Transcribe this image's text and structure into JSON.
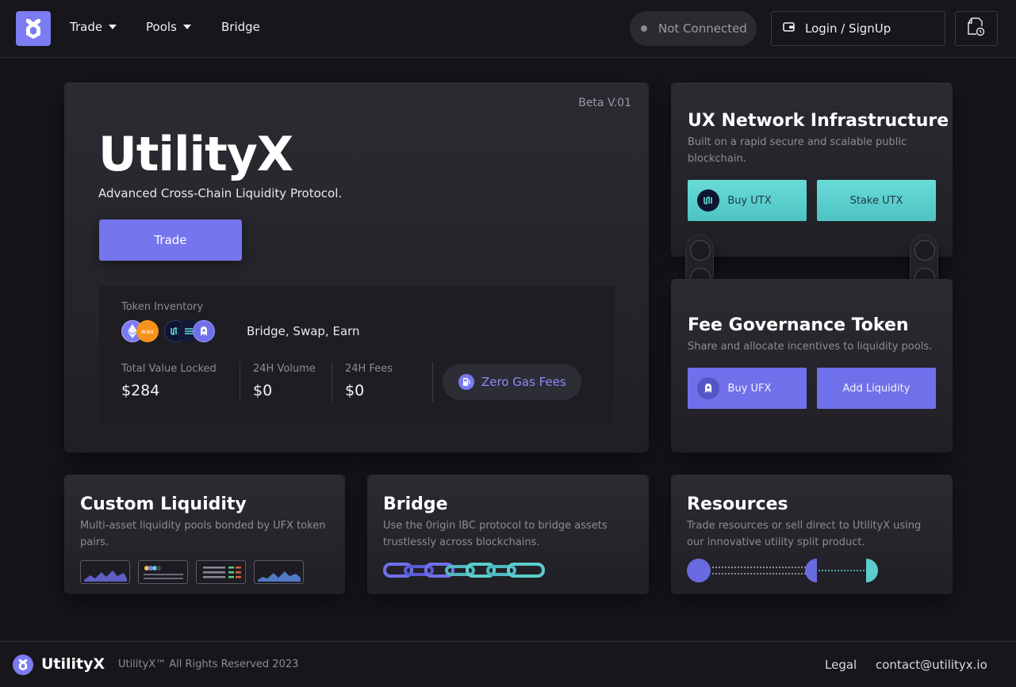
{
  "header": {
    "logo_icon": "utilityx-logo-icon",
    "nav": [
      {
        "label": "Trade",
        "has_dropdown": true
      },
      {
        "label": "Pools",
        "has_dropdown": true
      },
      {
        "label": "Bridge",
        "has_dropdown": false
      }
    ],
    "connection_status": "Not Connected",
    "login_label": "Login / SignUp",
    "login_icon": "wallet-icon",
    "docs_icon": "document-clock-icon"
  },
  "hero": {
    "version": "Beta V.01",
    "title": "UtilityX",
    "subtitle": "Advanced Cross-Chain Liquidity Protocol.",
    "trade_label": "Trade",
    "inventory": {
      "label": "Token Inventory",
      "coin_icons": [
        "eth-icon",
        "wax-icon",
        "utx-icon",
        "bridge-token-icon",
        "ufx-icon"
      ],
      "tagline": "Bridge, Swap, Earn",
      "stats": [
        {
          "label": "Total Value Locked",
          "value": "$284"
        },
        {
          "label": "24H Volume",
          "value": "$0"
        },
        {
          "label": "24H Fees",
          "value": "$0"
        }
      ],
      "gas_label": "Zero Gas Fees",
      "gas_icon": "gas-pump-icon"
    }
  },
  "ux_card": {
    "title": "UX Network Infrastructure",
    "description": "Built on a rapid secure and scalable public blockchain.",
    "buy_label": "Buy UTX",
    "stake_label": "Stake UTX"
  },
  "fee_card": {
    "title": "Fee Governance Token",
    "description": "Share and allocate incentives to liquidity pools.",
    "buy_label": "Buy UFX",
    "add_label": "Add Liquidity"
  },
  "custom_liquidity": {
    "title": "Custom Liquidity",
    "description": "Multi-asset liquidity pools bonded by UFX token pairs."
  },
  "bridge_card": {
    "title": "Bridge",
    "description": "Use the 0rigin IBC protocol to bridge assets trustlessly across blockchains."
  },
  "resources_card": {
    "title": "Resources",
    "description": "Trade resources or sell direct to UtilityX using our innovative utility split product."
  },
  "colors": {
    "accent_purple": "#7575ee",
    "accent_teal": "#5ccdcc",
    "background": "#15151a"
  },
  "footer": {
    "brand": "UtilityX",
    "copyright": "UtilityX™ All Rights Reserved 2023",
    "legal_label": "Legal",
    "contact_label": "contact@utilityx.io"
  }
}
